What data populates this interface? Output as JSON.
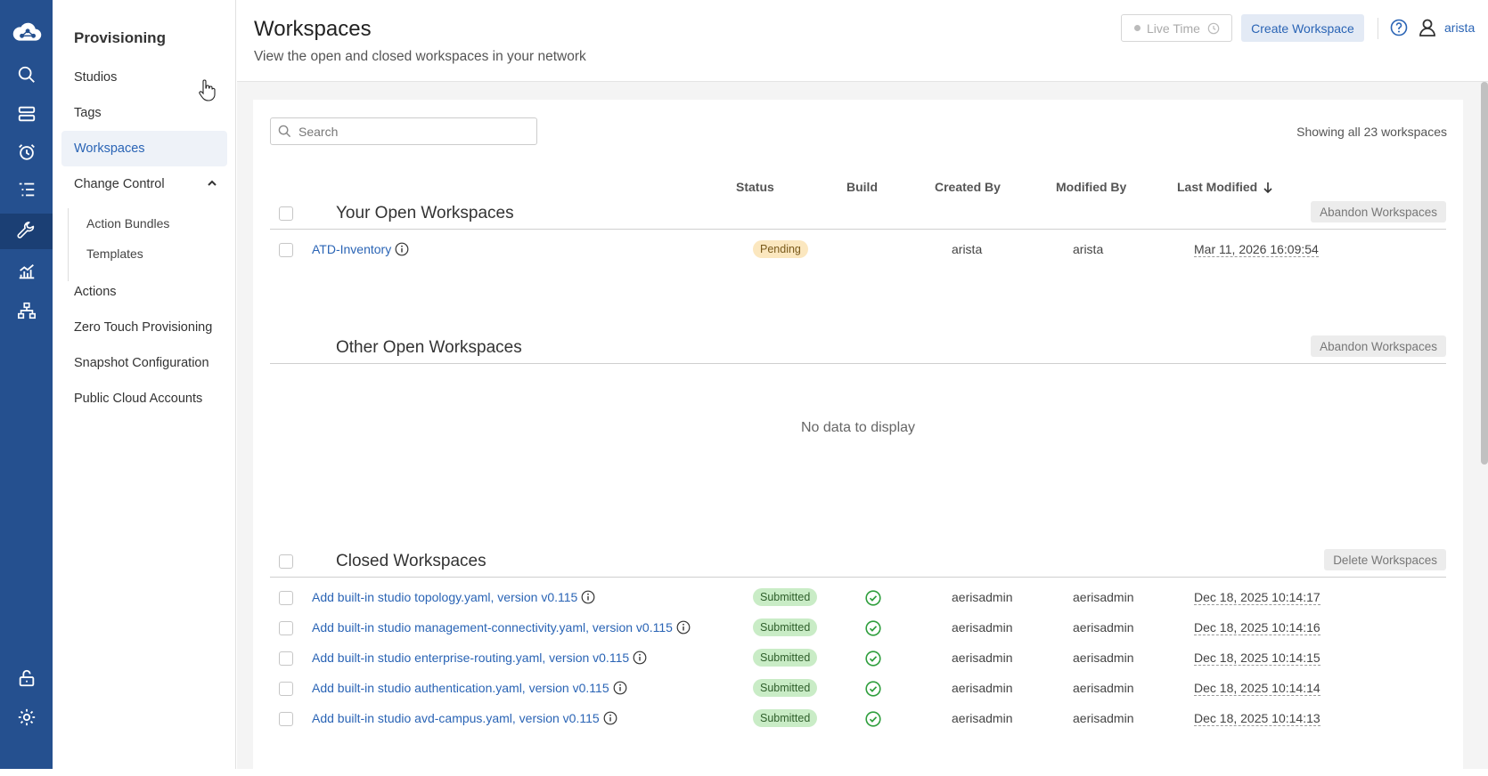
{
  "rail": {
    "icons": [
      "cloud-logo-icon",
      "search-icon",
      "devices-icon",
      "alarm-icon",
      "events-list-icon",
      "wrench-icon",
      "dashboard-chart-icon",
      "topology-icon",
      "unlock-icon",
      "gear-icon"
    ]
  },
  "nav": {
    "title": "Provisioning",
    "items": {
      "studios": "Studios",
      "tags": "Tags",
      "workspaces": "Workspaces",
      "change_control": "Change Control",
      "action_bundles": "Action Bundles",
      "templates": "Templates",
      "actions": "Actions",
      "ztp": "Zero Touch Provisioning",
      "snapshot": "Snapshot Configuration",
      "cloud": "Public Cloud Accounts"
    }
  },
  "header": {
    "title": "Workspaces",
    "subtitle": "View the open and closed workspaces in your network",
    "live_time": "Live Time",
    "create_button": "Create Workspace",
    "user": "arista"
  },
  "search": {
    "placeholder": "Search"
  },
  "showing": "Showing all 23 workspaces",
  "columns": {
    "status": "Status",
    "build": "Build",
    "created_by": "Created By",
    "modified_by": "Modified By",
    "last_modified": "Last Modified"
  },
  "sections": {
    "open": {
      "title": "Your Open Workspaces",
      "button": "Abandon Workspaces"
    },
    "other": {
      "title": "Other Open Workspaces",
      "button": "Abandon Workspaces",
      "empty": "No data to display"
    },
    "closed": {
      "title": "Closed Workspaces",
      "button": "Delete Workspaces"
    }
  },
  "open_rows": [
    {
      "name": "ATD-Inventory",
      "status": "Pending",
      "created_by": "arista",
      "modified_by": "arista",
      "last_modified": "Mar 11, 2026 16:09:54"
    }
  ],
  "closed_rows": [
    {
      "name": "Add built-in studio topology.yaml, version v0.115",
      "status": "Submitted",
      "created_by": "aerisadmin",
      "modified_by": "aerisadmin",
      "last_modified": "Dec 18, 2025 10:14:17"
    },
    {
      "name": "Add built-in studio management-connectivity.yaml, version v0.115",
      "status": "Submitted",
      "created_by": "aerisadmin",
      "modified_by": "aerisadmin",
      "last_modified": "Dec 18, 2025 10:14:16"
    },
    {
      "name": "Add built-in studio enterprise-routing.yaml, version v0.115",
      "status": "Submitted",
      "created_by": "aerisadmin",
      "modified_by": "aerisadmin",
      "last_modified": "Dec 18, 2025 10:14:15"
    },
    {
      "name": "Add built-in studio authentication.yaml, version v0.115",
      "status": "Submitted",
      "created_by": "aerisadmin",
      "modified_by": "aerisadmin",
      "last_modified": "Dec 18, 2025 10:14:14"
    },
    {
      "name": "Add built-in studio avd-campus.yaml, version v0.115",
      "status": "Submitted",
      "created_by": "aerisadmin",
      "modified_by": "aerisadmin",
      "last_modified": "Dec 18, 2025 10:14:13"
    }
  ],
  "colors": {
    "rail": "#25508f",
    "accent": "#2a64b5",
    "pending": "#fbe7bf",
    "submitted": "#c9ecc6",
    "success": "#2e9e3c"
  }
}
